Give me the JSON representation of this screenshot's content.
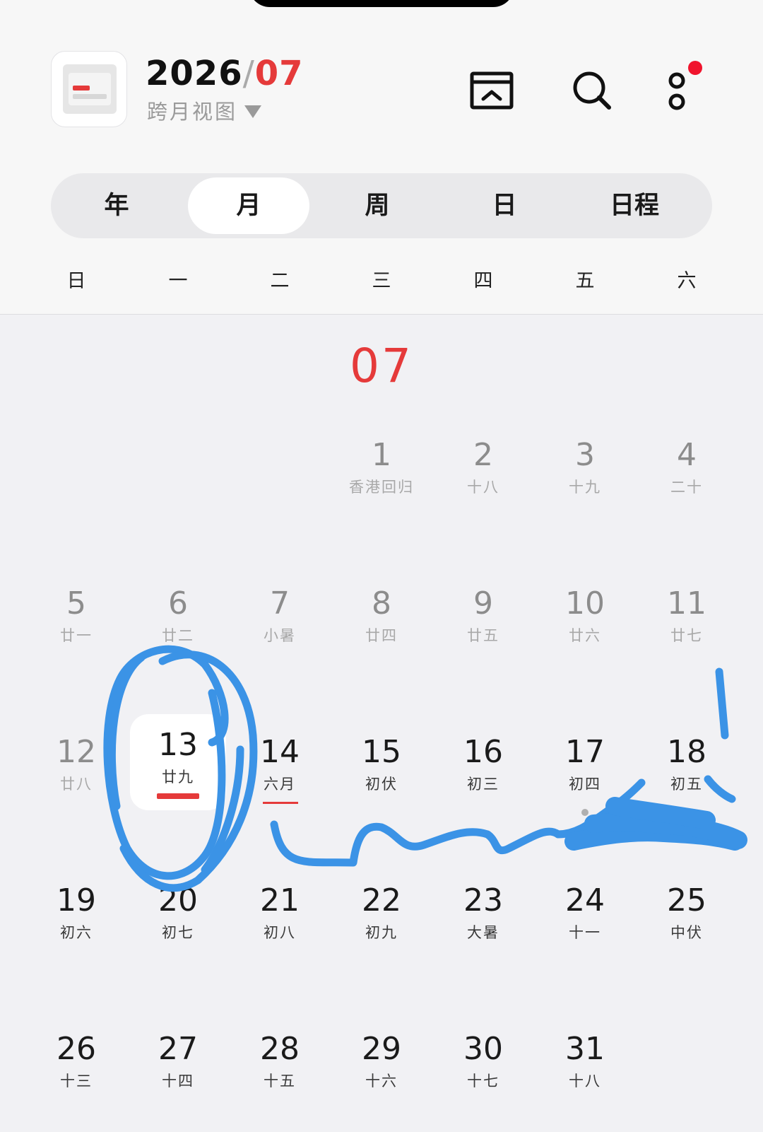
{
  "header": {
    "year": "2026",
    "slash": "/",
    "month": "07",
    "view_label": "跨月视图"
  },
  "toolbar": {
    "icons": [
      "app-logo-icon",
      "back-to-today-icon",
      "search-icon",
      "more-icon"
    ],
    "notification_dot_color": "#f0142d"
  },
  "tabs": [
    {
      "label": "年",
      "active": false
    },
    {
      "label": "月",
      "active": true
    },
    {
      "label": "周",
      "active": false
    },
    {
      "label": "日",
      "active": false
    },
    {
      "label": "日程",
      "active": false
    }
  ],
  "weekdays": [
    "日",
    "一",
    "二",
    "三",
    "四",
    "五",
    "六"
  ],
  "month_label": "07",
  "days": [
    {
      "num": "1",
      "sub": "香港回归"
    },
    {
      "num": "2",
      "sub": "十八"
    },
    {
      "num": "3",
      "sub": "十九"
    },
    {
      "num": "4",
      "sub": "二十"
    },
    {
      "num": "5",
      "sub": "廿一"
    },
    {
      "num": "6",
      "sub": "廿二"
    },
    {
      "num": "7",
      "sub": "小暑"
    },
    {
      "num": "8",
      "sub": "廿四"
    },
    {
      "num": "9",
      "sub": "廿五"
    },
    {
      "num": "10",
      "sub": "廿六"
    },
    {
      "num": "11",
      "sub": "廿七"
    },
    {
      "num": "12",
      "sub": "廿八"
    },
    {
      "num": "13",
      "sub": "廿九"
    },
    {
      "num": "14",
      "sub": "六月"
    },
    {
      "num": "15",
      "sub": "初伏"
    },
    {
      "num": "16",
      "sub": "初三"
    },
    {
      "num": "17",
      "sub": "初四"
    },
    {
      "num": "18",
      "sub": "初五"
    },
    {
      "num": "19",
      "sub": "初六"
    },
    {
      "num": "20",
      "sub": "初七"
    },
    {
      "num": "21",
      "sub": "初八"
    },
    {
      "num": "22",
      "sub": "初九"
    },
    {
      "num": "23",
      "sub": "大暑"
    },
    {
      "num": "24",
      "sub": "十一"
    },
    {
      "num": "25",
      "sub": "中伏"
    },
    {
      "num": "26",
      "sub": "十三"
    },
    {
      "num": "27",
      "sub": "十四"
    },
    {
      "num": "28",
      "sub": "十五"
    },
    {
      "num": "29",
      "sub": "十六"
    },
    {
      "num": "30",
      "sub": "十七"
    },
    {
      "num": "31",
      "sub": "十八"
    }
  ],
  "colors": {
    "accent": "#e53a3a",
    "annotation": "#3b93e6",
    "past_text": "#8c8c8c"
  }
}
